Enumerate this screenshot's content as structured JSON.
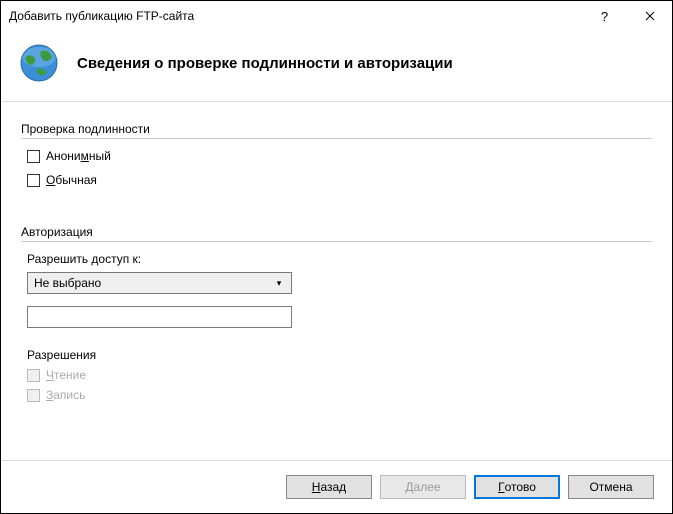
{
  "window": {
    "title": "Добавить публикацию FTP-сайта"
  },
  "header": {
    "title": "Сведения о проверке подлинности и авторизации"
  },
  "auth": {
    "group": "Проверка подлинности",
    "anon_pre": "Анони",
    "anon_u": "м",
    "anon_post": "ный",
    "basic_u": "О",
    "basic_post": "бычная"
  },
  "authorization": {
    "group": "Авторизация",
    "allow_label": "Разрешить доступ к:",
    "select_value": "Не выбрано",
    "permissions_label": "Разрешения",
    "read_u": "Ч",
    "read_post": "тение",
    "write_u": "З",
    "write_post": "апись"
  },
  "footer": {
    "back_u": "Н",
    "back_post": "азад",
    "next_u": "Д",
    "next_post": "алее",
    "finish_u": "Г",
    "finish_post": "отово",
    "cancel": "Отмена"
  }
}
